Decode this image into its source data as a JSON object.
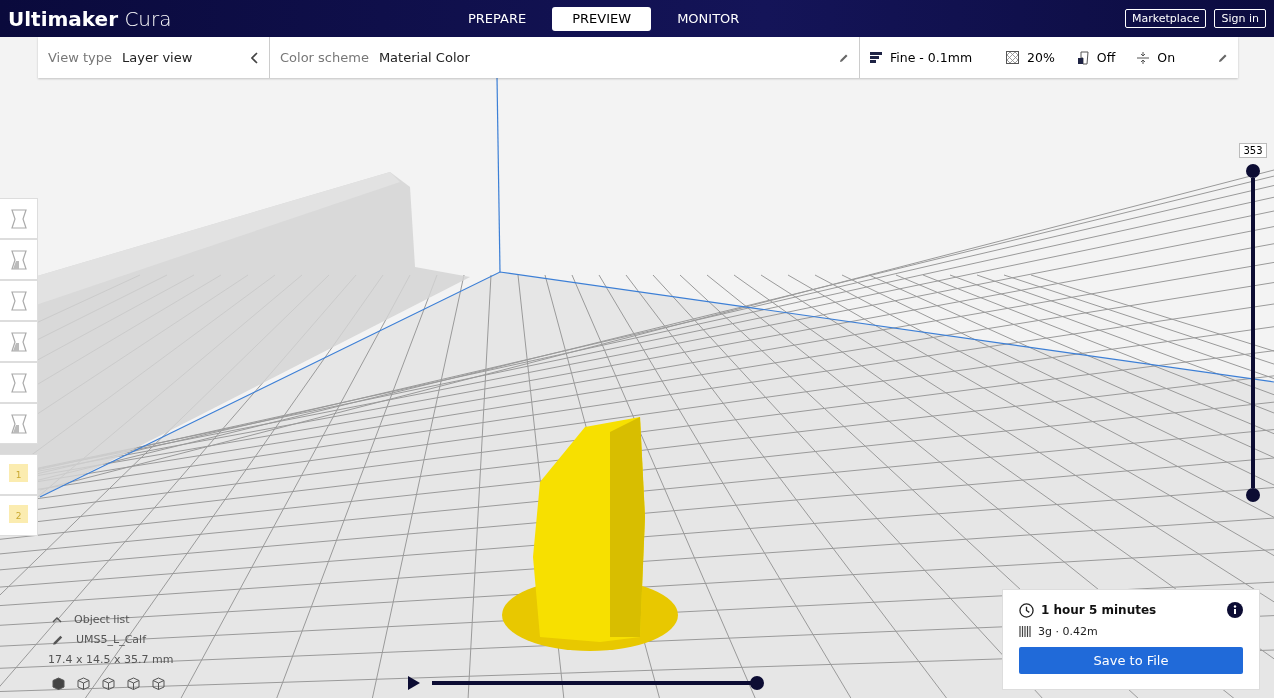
{
  "header": {
    "logo_bold": "Ultimaker",
    "logo_light": "Cura",
    "tabs": [
      {
        "label": "PREPARE",
        "selected": false
      },
      {
        "label": "PREVIEW",
        "selected": true
      },
      {
        "label": "MONITOR",
        "selected": false
      }
    ],
    "buttons": [
      "Marketplace",
      "Sign in"
    ]
  },
  "view_bar": {
    "view_type_label": "View type",
    "view_type": "Layer view",
    "color_scheme_label": "Color scheme",
    "color_scheme": "Material Color"
  },
  "print_settings": {
    "profile": "Fine - 0.1mm",
    "infill": "20%",
    "support": "Off",
    "adhesion": "On"
  },
  "tools": [
    {
      "kind": "tool"
    },
    {
      "kind": "tool"
    },
    {
      "kind": "tool"
    },
    {
      "kind": "tool"
    },
    {
      "kind": "tool"
    },
    {
      "kind": "tool"
    },
    {
      "kind": "extruder",
      "label": "1"
    },
    {
      "kind": "extruder",
      "label": "2"
    }
  ],
  "layer_slider": {
    "reading": "353",
    "level": 1
  },
  "path_slider": {
    "level": 1
  },
  "object_list": {
    "title": "Object list",
    "object": "UMS5_L_Calf",
    "dimensions": "17.4 x 14.5 x 35.7 mm"
  },
  "print_card": {
    "time": "1 hour 5 minutes",
    "material": "3g · 0.42m",
    "button": "Save to File"
  }
}
